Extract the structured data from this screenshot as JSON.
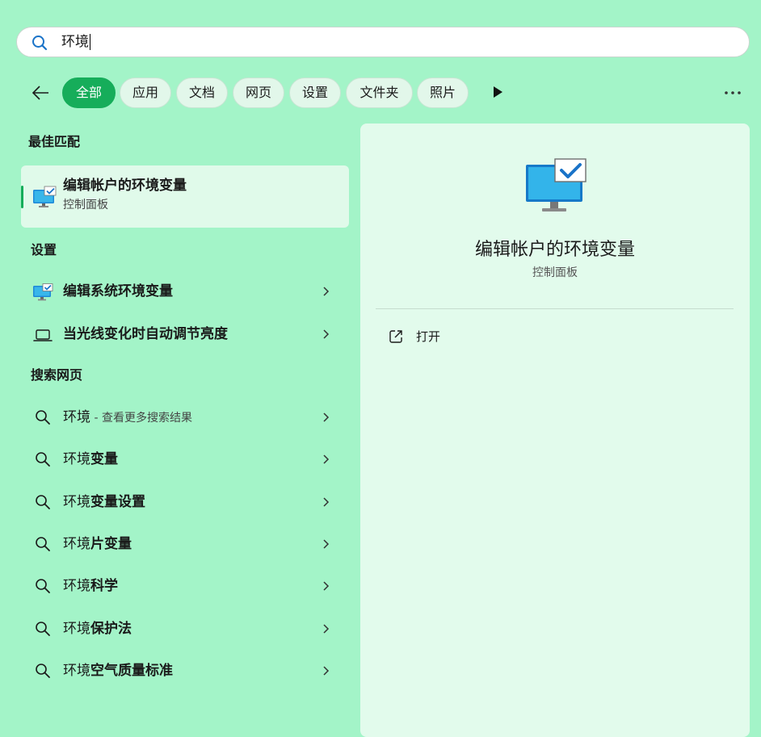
{
  "search": {
    "query": "环境"
  },
  "filters": [
    "全部",
    "应用",
    "文档",
    "网页",
    "设置",
    "文件夹",
    "照片"
  ],
  "best_match": {
    "heading": "最佳匹配",
    "title": "编辑帐户的环境变量",
    "subtitle": "控制面板"
  },
  "settings": {
    "heading": "设置",
    "items": [
      {
        "label": "编辑系统环境变量",
        "icon": "monitor-icon"
      },
      {
        "label": "当光线变化时自动调节亮度",
        "icon": "laptop-icon"
      }
    ]
  },
  "web": {
    "heading": "搜索网页",
    "first": {
      "term": "环境",
      "hint": " - 查看更多搜索结果"
    },
    "items": [
      {
        "prefix": "环境",
        "bold": "变量"
      },
      {
        "prefix": "环境",
        "bold": "变量设置"
      },
      {
        "prefix": "环境",
        "bold": "片变量"
      },
      {
        "prefix": "环境",
        "bold": "科学"
      },
      {
        "prefix": "环境",
        "bold": "保护法"
      },
      {
        "prefix": "环境",
        "bold": "空气质量标准"
      }
    ]
  },
  "preview": {
    "title": "编辑帐户的环境变量",
    "subtitle": "控制面板",
    "action": "打开"
  },
  "colors": {
    "accent": "#16ad5a",
    "background": "#a3f4c8",
    "panel": "#e2fbec"
  }
}
